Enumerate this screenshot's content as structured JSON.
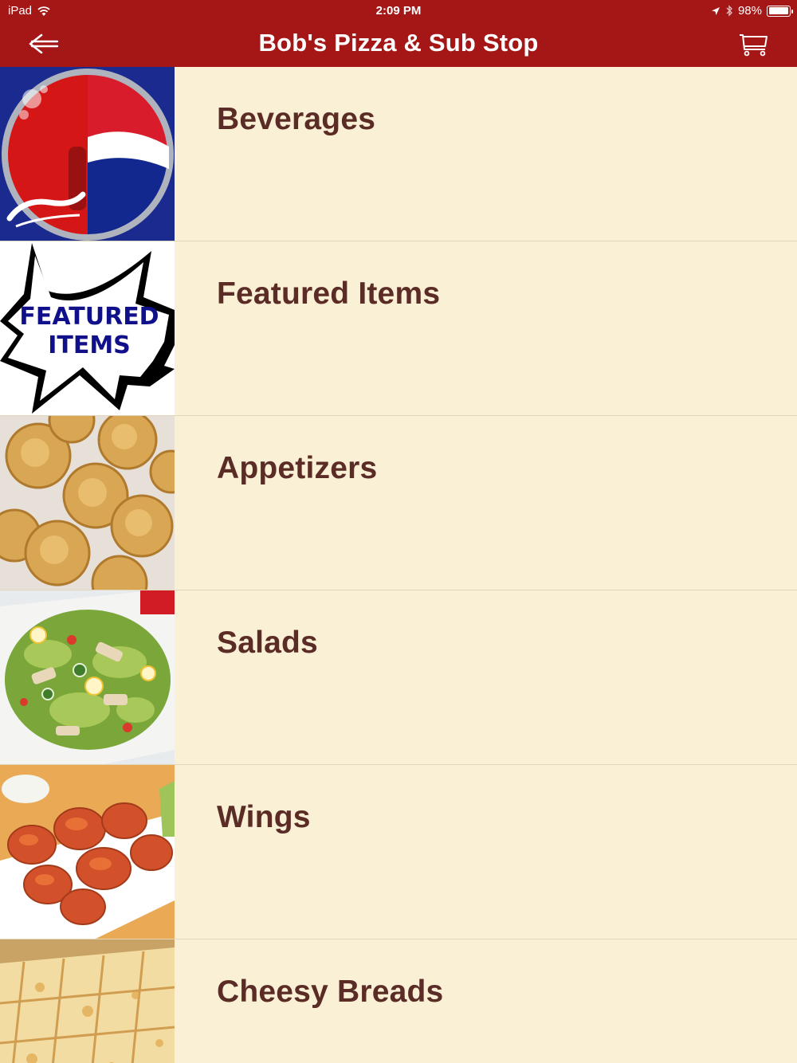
{
  "status_bar": {
    "device": "iPad",
    "time": "2:09 PM",
    "battery": "98%",
    "battery_level": 0.98
  },
  "header": {
    "title": "Bob's Pizza & Sub Stop",
    "back_icon": "back-arrow-icon",
    "cart_icon": "cart-icon"
  },
  "colors": {
    "header_bg": "#a51717",
    "list_bg": "#f9f0d6",
    "label_text": "#5b2b25",
    "divider": "#e1d6b9"
  },
  "menu": {
    "items": [
      {
        "label": "Beverages",
        "image": "coca-cola-pepsi-bottle-caps-image"
      },
      {
        "label": "Featured Items",
        "image": "featured-items-starburst-image",
        "image_text": "FEATURED ITEMS"
      },
      {
        "label": "Appetizers",
        "image": "mac-and-cheese-bites-image"
      },
      {
        "label": "Salads",
        "image": "chicken-salad-image"
      },
      {
        "label": "Wings",
        "image": "buffalo-wings-image"
      },
      {
        "label": "Cheesy Breads",
        "image": "cheesy-bread-image"
      }
    ]
  }
}
